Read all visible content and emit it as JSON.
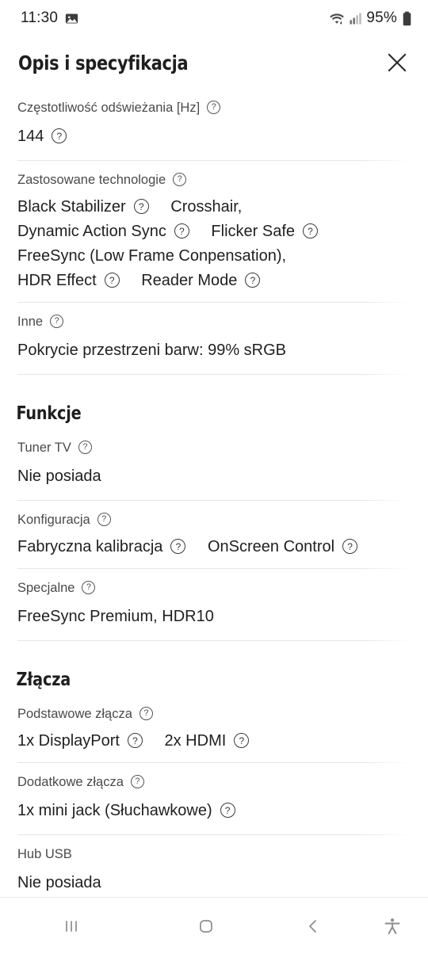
{
  "statusbar": {
    "time": "11:30",
    "battery_percent": "95%",
    "icons": {
      "photo": "photo-icon",
      "wifi": "wifi-icon",
      "signal": "cellular-signal-icon",
      "battery": "battery-icon"
    }
  },
  "header": {
    "title": "Opis i specyfikacja",
    "close_label": "close-icon"
  },
  "help_glyph": "?",
  "specs": [
    {
      "label": "Częstotliwość odświeżania [Hz]",
      "label_help": true,
      "values": [
        {
          "text": "144",
          "help": true
        }
      ]
    },
    {
      "label": "Zastosowane technologie",
      "label_help": true,
      "values": [
        {
          "text": "Black Stabilizer",
          "help": true
        },
        {
          "text": "Crosshair,",
          "help": false
        },
        {
          "text": "Dynamic Action Sync",
          "help": true
        },
        {
          "text": "Flicker Safe",
          "help": true
        },
        {
          "text": "FreeSync (Low Frame Conpensation),",
          "help": false
        },
        {
          "text": "HDR Effect",
          "help": true
        },
        {
          "text": "Reader Mode",
          "help": true
        }
      ]
    },
    {
      "label": "Inne",
      "label_help": true,
      "values": [
        {
          "text": "Pokrycie przestrzeni barw: 99% sRGB",
          "help": false
        }
      ]
    }
  ],
  "sections": [
    {
      "title": "Funkcje",
      "specs": [
        {
          "label": "Tuner TV",
          "label_help": true,
          "values": [
            {
              "text": "Nie posiada",
              "help": false
            }
          ]
        },
        {
          "label": "Konfiguracja",
          "label_help": true,
          "values": [
            {
              "text": "Fabryczna kalibracja",
              "help": true
            },
            {
              "text": "OnScreen Control",
              "help": true
            }
          ]
        },
        {
          "label": "Specjalne",
          "label_help": true,
          "values": [
            {
              "text": "FreeSync Premium, HDR10",
              "help": false
            }
          ]
        }
      ]
    },
    {
      "title": "Złącza",
      "specs": [
        {
          "label": "Podstawowe złącza",
          "label_help": true,
          "values": [
            {
              "text": "1x DisplayPort",
              "help": true
            },
            {
              "text": "2x HDMI",
              "help": true
            }
          ]
        },
        {
          "label": "Dodatkowe złącza",
          "label_help": true,
          "values": [
            {
              "text": "1x mini jack (Słuchawkowe)",
              "help": true
            }
          ]
        },
        {
          "label": "Hub USB",
          "label_help": false,
          "values": [
            {
              "text": "Nie posiada",
              "help": false
            }
          ]
        }
      ]
    }
  ],
  "navbar": {
    "recents": "recents-icon",
    "home": "home-icon",
    "back": "back-icon",
    "accessibility": "accessibility-icon"
  },
  "colors": {
    "text_primary": "#1f1f1f",
    "text_label": "#4a4a4a",
    "divider": "#e6e6e8",
    "nav_icon": "#8c8c8c",
    "background": "#ffffff"
  }
}
